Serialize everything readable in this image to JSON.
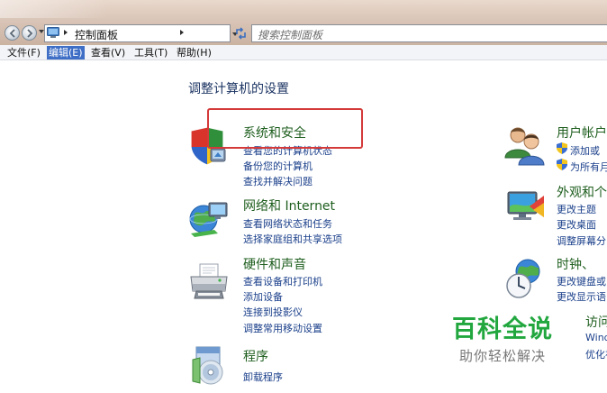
{
  "address": {
    "path": "控制面板",
    "search_placeholder": "搜索控制面板"
  },
  "menu": [
    {
      "label": "文件(F)"
    },
    {
      "label": "编辑(E)"
    },
    {
      "label": "查看(V)"
    },
    {
      "label": "工具(T)"
    },
    {
      "label": "帮助(H)"
    }
  ],
  "page_title": "调整计算机的设置",
  "left_categories": [
    {
      "title": "系统和安全",
      "icon": "shield-icon",
      "links": [
        "查看您的计算机状态",
        "备份您的计算机",
        "查找并解决问题"
      ]
    },
    {
      "title": "网络和 Internet",
      "icon": "network-globe-icon",
      "links": [
        "查看网络状态和任务",
        "选择家庭组和共享选项"
      ]
    },
    {
      "title": "硬件和声音",
      "icon": "printer-icon",
      "links": [
        "查看设备和打印机",
        "添加设备",
        "连接到投影仪",
        "调整常用移动设置"
      ]
    },
    {
      "title": "程序",
      "icon": "programs-icon",
      "links": [
        "卸载程序"
      ]
    }
  ],
  "right_categories": [
    {
      "title": "用户帐户",
      "icon": "users-icon",
      "links": [
        "添加或",
        "为所有月"
      ]
    },
    {
      "title": "外观和个",
      "icon": "appearance-icon",
      "links": [
        "更改主题",
        "更改桌面",
        "调整屏幕分"
      ]
    },
    {
      "title": "时钟、",
      "icon": "clock-globe-icon",
      "links": [
        "更改键盘或",
        "更改显示语"
      ]
    },
    {
      "title": "访问",
      "icon": "",
      "links": [
        "Windo",
        "优化视"
      ]
    }
  ],
  "watermark": {
    "title": "百科全说",
    "subtitle": "助你轻松解决"
  },
  "colors": {
    "category_title": "#1e5e1e",
    "link": "#1a3f8a",
    "highlight": "#d43a3a",
    "watermark_green": "#22a73f"
  }
}
